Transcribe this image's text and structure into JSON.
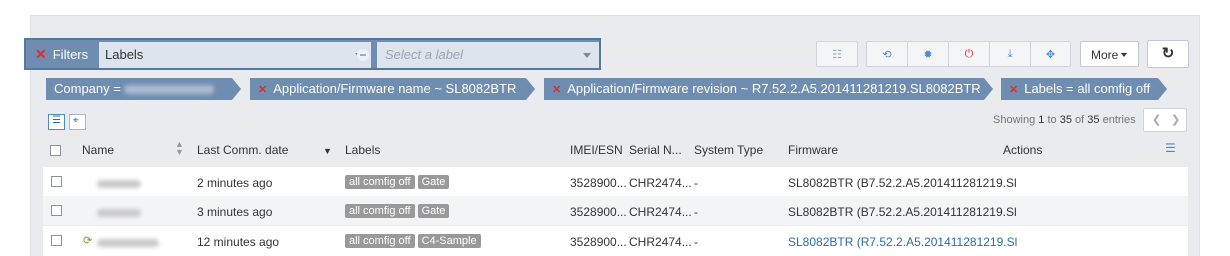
{
  "filter": {
    "clear_icon": "x-icon",
    "title": "Filters",
    "field_value": "Labels",
    "operator_icon": "equals-icon",
    "value_placeholder": "Select a label"
  },
  "toolbar": {
    "icons": [
      "list-icon",
      "sync-icon",
      "settings-icon",
      "power-icon",
      "download-icon",
      "target-icon"
    ],
    "more_label": "More",
    "refresh_icon": "refresh-icon"
  },
  "active_filters": [
    {
      "text": "Company = "
    },
    {
      "text": "Application/Firmware name ~ SL8082BTR"
    },
    {
      "text": "Application/Firmware revision ~ R7.52.2.A5.201411281219.SL8082BTR"
    },
    {
      "text": "Labels = all comfig off"
    }
  ],
  "view_toggles": [
    "list-view-icon",
    "map-view-icon"
  ],
  "pagination": {
    "prefix": "Showing",
    "from": "1",
    "to_label": "to",
    "to": "35",
    "of_label": "of",
    "total": "35",
    "suffix": "entries"
  },
  "columns": [
    "Name",
    "Last Comm. date",
    "Labels",
    "IMEI/ESN",
    "Serial N...",
    "System Type",
    "Firmware",
    "Actions"
  ],
  "rows": [
    {
      "last_comm": "2 minutes ago",
      "labels": [
        "all comfig off",
        "Gate"
      ],
      "imei": "3528900...",
      "serial": "CHR2474...",
      "system_type": "-",
      "firmware": "SL8082BTR (B7.52.2.A5.201411281219.Sl"
    },
    {
      "last_comm": "3 minutes ago",
      "labels": [
        "all comfig off",
        "Gate"
      ],
      "imei": "3528900...",
      "serial": "CHR2474...",
      "system_type": "-",
      "firmware": "SL8082BTR (B7.52.2.A5.201411281219.Sl"
    },
    {
      "last_comm": "12 minutes ago",
      "labels": [
        "all comfig off",
        "C4-Sample"
      ],
      "imei": "3528900...",
      "serial": "CHR2474...",
      "system_type": "-",
      "firmware": "SL8082BTR (R7.52.2.A5.201411281219.Sl"
    }
  ],
  "colors": {
    "accent": "#6f8db0",
    "danger": "#d9302c",
    "link": "#2c6ca3",
    "status_ok": "#6aa121"
  }
}
